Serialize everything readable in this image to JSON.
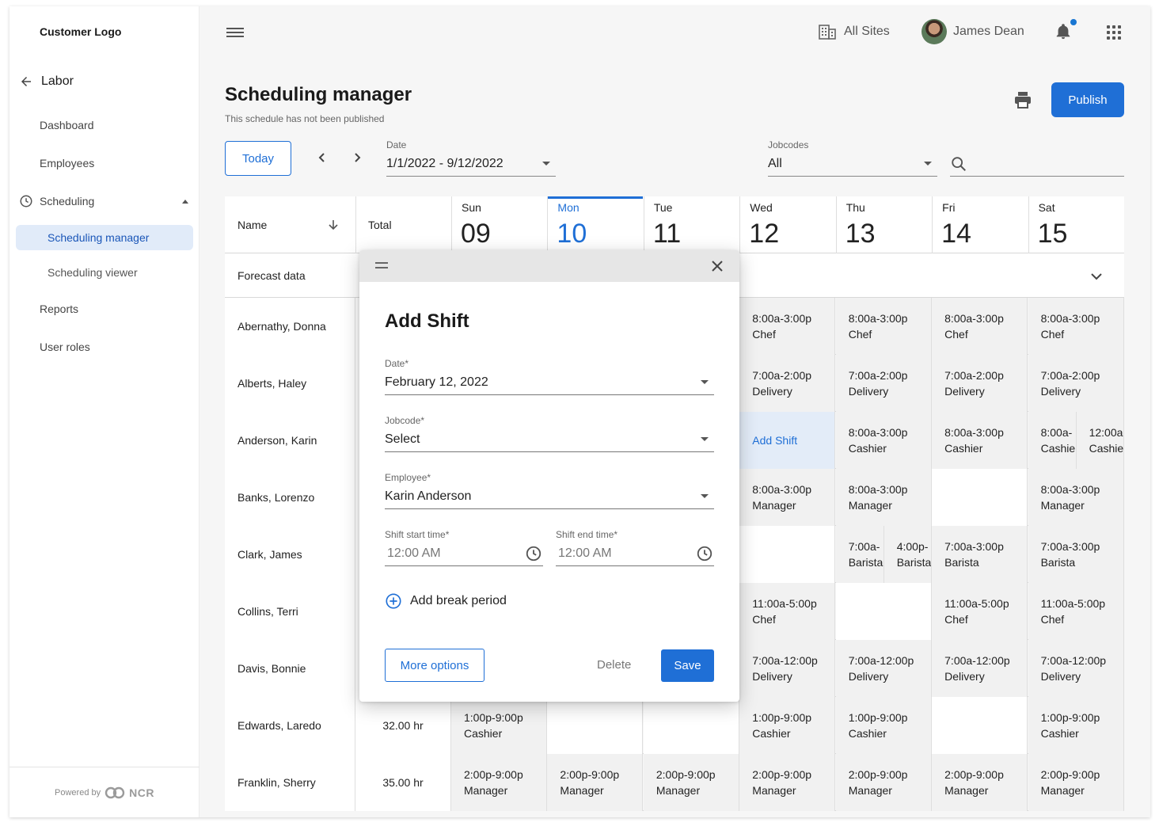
{
  "sidebar": {
    "logo": "Customer Logo",
    "back_label": "Labor",
    "items": [
      "Dashboard",
      "Employees"
    ],
    "scheduling_label": "Scheduling",
    "sub_items": [
      "Scheduling manager",
      "Scheduling viewer"
    ],
    "more_items": [
      "Reports",
      "User roles"
    ],
    "powered_by": "Powered by",
    "powered_brand": "NCR"
  },
  "topbar": {
    "sites_label": "All Sites",
    "user_name": "James Dean",
    "notification_dot_color": "#1976d2"
  },
  "page": {
    "title": "Scheduling manager",
    "subtitle": "This schedule has not been published",
    "publish_label": "Publish",
    "accent_color": "#1f6fd6"
  },
  "filters": {
    "today_label": "Today",
    "date_label": "Date",
    "date_value": "1/1/2022 - 9/12/2022",
    "jobcodes_label": "Jobcodes",
    "jobcodes_value": "All"
  },
  "grid": {
    "name_header": "Name",
    "total_header": "Total",
    "days": [
      {
        "name": "Sun",
        "date": "09"
      },
      {
        "name": "Mon",
        "date": "10"
      },
      {
        "name": "Tue",
        "date": "11"
      },
      {
        "name": "Wed",
        "date": "12"
      },
      {
        "name": "Thu",
        "date": "13"
      },
      {
        "name": "Fri",
        "date": "14"
      },
      {
        "name": "Sat",
        "date": "15"
      }
    ],
    "forecast_label": "Forecast data",
    "add_shift_label": "Add Shift",
    "rows": [
      {
        "name": "Abernathy, Donna",
        "total": "",
        "cells": [
          null,
          null,
          null,
          [
            "8:00a-3:00p",
            "Chef"
          ],
          [
            "8:00a-3:00p",
            "Chef"
          ],
          [
            "8:00a-3:00p",
            "Chef"
          ],
          [
            "8:00a-3:00p",
            "Chef"
          ]
        ]
      },
      {
        "name": "Alberts, Haley",
        "total": "",
        "cells": [
          null,
          null,
          null,
          [
            "7:00a-2:00p",
            "Delivery"
          ],
          [
            "7:00a-2:00p",
            "Delivery"
          ],
          [
            "7:00a-2:00p",
            "Delivery"
          ],
          [
            "7:00a-2:00p",
            "Delivery"
          ]
        ]
      },
      {
        "name": "Anderson, Karin",
        "total": "",
        "cells": [
          null,
          null,
          null,
          "add",
          [
            "8:00a-3:00p",
            "Cashier"
          ],
          [
            "8:00a-3:00p",
            "Cashier"
          ],
          [
            [
              "8:00a-",
              "Cashier"
            ],
            [
              "12:00a",
              "Cashier"
            ]
          ]
        ]
      },
      {
        "name": "Banks, Lorenzo",
        "total": "",
        "cells": [
          null,
          null,
          null,
          [
            "8:00a-3:00p",
            "Manager"
          ],
          [
            "8:00a-3:00p",
            "Manager"
          ],
          "empty",
          [
            "8:00a-3:00p",
            "Manager"
          ]
        ]
      },
      {
        "name": "Clark, James",
        "total": "",
        "cells": [
          null,
          null,
          null,
          "empty",
          [
            [
              "7:00a-",
              "Barista"
            ],
            [
              "4:00p-",
              "Barista"
            ]
          ],
          [
            "7:00a-3:00p",
            "Barista"
          ],
          [
            "7:00a-3:00p",
            "Barista"
          ]
        ]
      },
      {
        "name": "Collins, Terri",
        "total": "",
        "cells": [
          null,
          null,
          null,
          [
            "11:00a-5:00p",
            "Chef"
          ],
          "empty",
          [
            "11:00a-5:00p",
            "Chef"
          ],
          [
            "11:00a-5:00p",
            "Chef"
          ]
        ]
      },
      {
        "name": "Davis, Bonnie",
        "total": "",
        "cells": [
          null,
          null,
          null,
          [
            "7:00a-12:00p",
            "Delivery"
          ],
          [
            "7:00a-12:00p",
            "Delivery"
          ],
          [
            "7:00a-12:00p",
            "Delivery"
          ],
          [
            "7:00a-12:00p",
            "Delivery"
          ]
        ]
      },
      {
        "name": "Edwards, Laredo",
        "total": "32.00 hr",
        "cells": [
          [
            "1:00p-9:00p",
            "Cashier"
          ],
          "empty",
          "empty",
          [
            "1:00p-9:00p",
            "Cashier"
          ],
          [
            "1:00p-9:00p",
            "Cashier"
          ],
          "empty",
          [
            "1:00p-9:00p",
            "Cashier"
          ]
        ]
      },
      {
        "name": "Franklin, Sherry",
        "total": "35.00 hr",
        "cells": [
          [
            "2:00p-9:00p",
            "Manager"
          ],
          [
            "2:00p-9:00p",
            "Manager"
          ],
          [
            "2:00p-9:00p",
            "Manager"
          ],
          [
            "2:00p-9:00p",
            "Manager"
          ],
          [
            "2:00p-9:00p",
            "Manager"
          ],
          [
            "2:00p-9:00p",
            "Manager"
          ],
          [
            "2:00p-9:00p",
            "Manager"
          ]
        ]
      }
    ]
  },
  "modal": {
    "title": "Add Shift",
    "date_label": "Date*",
    "date_value": "February 12, 2022",
    "jobcode_label": "Jobcode*",
    "jobcode_value": "Select",
    "employee_label": "Employee*",
    "employee_value": "Karin Anderson",
    "start_label": "Shift start time*",
    "start_value": "12:00 AM",
    "end_label": "Shift end time*",
    "end_value": "12:00 AM",
    "add_break_label": "Add break period",
    "more_options_label": "More options",
    "delete_label": "Delete",
    "save_label": "Save"
  }
}
